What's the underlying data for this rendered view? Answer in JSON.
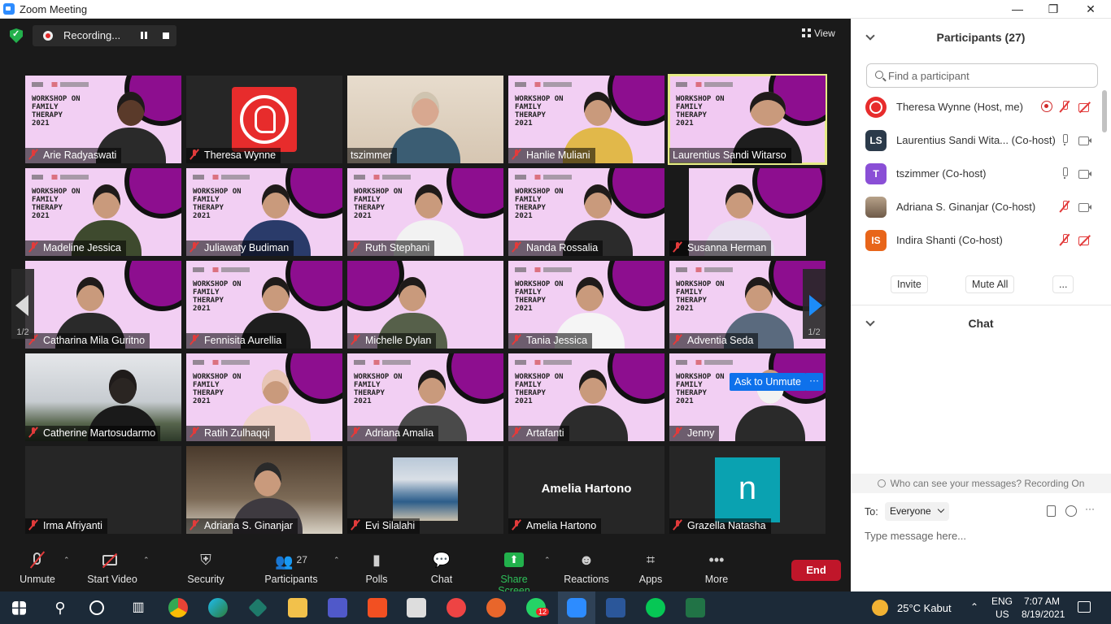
{
  "window": {
    "title": "Zoom Meeting",
    "controls": [
      "—",
      "❐",
      "✕"
    ]
  },
  "topbar": {
    "recording_label": "Recording...",
    "view_label": "View"
  },
  "gallery": {
    "page_indicator": "1/2",
    "ask_to_unmute": "Ask to Unmute",
    "ask_more": "···",
    "workshop_text": "WORKSHOP ON FAMILY THERAPY 2021",
    "tiles": [
      {
        "name": "Arie Radyaswati"
      },
      {
        "name": "Theresa Wynne"
      },
      {
        "name": "tszimmer"
      },
      {
        "name": "Hanlie Muliani"
      },
      {
        "name": "Laurentius Sandi Witarso"
      },
      {
        "name": "Madeline Jessica"
      },
      {
        "name": "Juliawaty Budiman"
      },
      {
        "name": "Ruth Stephani"
      },
      {
        "name": "Nanda Rossalia"
      },
      {
        "name": "Susanna Herman"
      },
      {
        "name": "Catharina Mila Guritno"
      },
      {
        "name": "Fennisita Aurellia"
      },
      {
        "name": "Michelle Dylan"
      },
      {
        "name": "Tania Jessica"
      },
      {
        "name": "Adventia Seda"
      },
      {
        "name": "Catherine Martosudarmo"
      },
      {
        "name": "Ratih Zulhaqqi"
      },
      {
        "name": "Adriana Amalia"
      },
      {
        "name": "Artafanti"
      },
      {
        "name": "Jenny"
      },
      {
        "name": "Irma Afriyanti"
      },
      {
        "name": "Adriana S. Ginanjar"
      },
      {
        "name": "Evi Silalahi"
      },
      {
        "name": "Amelia Hartono",
        "center_name": "Amelia Hartono"
      },
      {
        "name": "Grazella Natasha",
        "avatar_letter": "n"
      }
    ]
  },
  "toolbar": {
    "unmute": "Unmute",
    "start_video": "Start Video",
    "security": "Security",
    "participants": "Participants",
    "participants_count": "27",
    "polls": "Polls",
    "chat": "Chat",
    "share_screen": "Share Screen",
    "reactions": "Reactions",
    "apps": "Apps",
    "more": "More",
    "end": "End"
  },
  "participants_panel": {
    "title": "Participants (27)",
    "search_placeholder": "Find a participant",
    "list": [
      {
        "name": "Theresa Wynne (Host, me)",
        "initials": "",
        "avatar_color": "#e72c2c"
      },
      {
        "name": "Laurentius Sandi Wita...  (Co-host)",
        "initials": "LS",
        "avatar_color": "#2b3a4a"
      },
      {
        "name": "tszimmer (Co-host)",
        "initials": "T",
        "avatar_color": "#8a4fd6"
      },
      {
        "name": "Adriana S. Ginanjar (Co-host)",
        "initials": "",
        "avatar_color": "#8a7a6a"
      },
      {
        "name": "Indira Shanti (Co-host)",
        "initials": "IS",
        "avatar_color": "#e8651a"
      }
    ],
    "invite": "Invite",
    "mute_all": "Mute All",
    "more": "..."
  },
  "chat_panel": {
    "title": "Chat",
    "info": "Who can see your messages? Recording On",
    "to_label": "To:",
    "to_value": "Everyone",
    "input_placeholder": "Type message here..."
  },
  "taskbar": {
    "weather": "25°C  Kabut",
    "language_1": "ENG",
    "language_2": "US",
    "time": "7:07 AM",
    "date": "8/19/2021",
    "whatsapp_badge": "12"
  }
}
